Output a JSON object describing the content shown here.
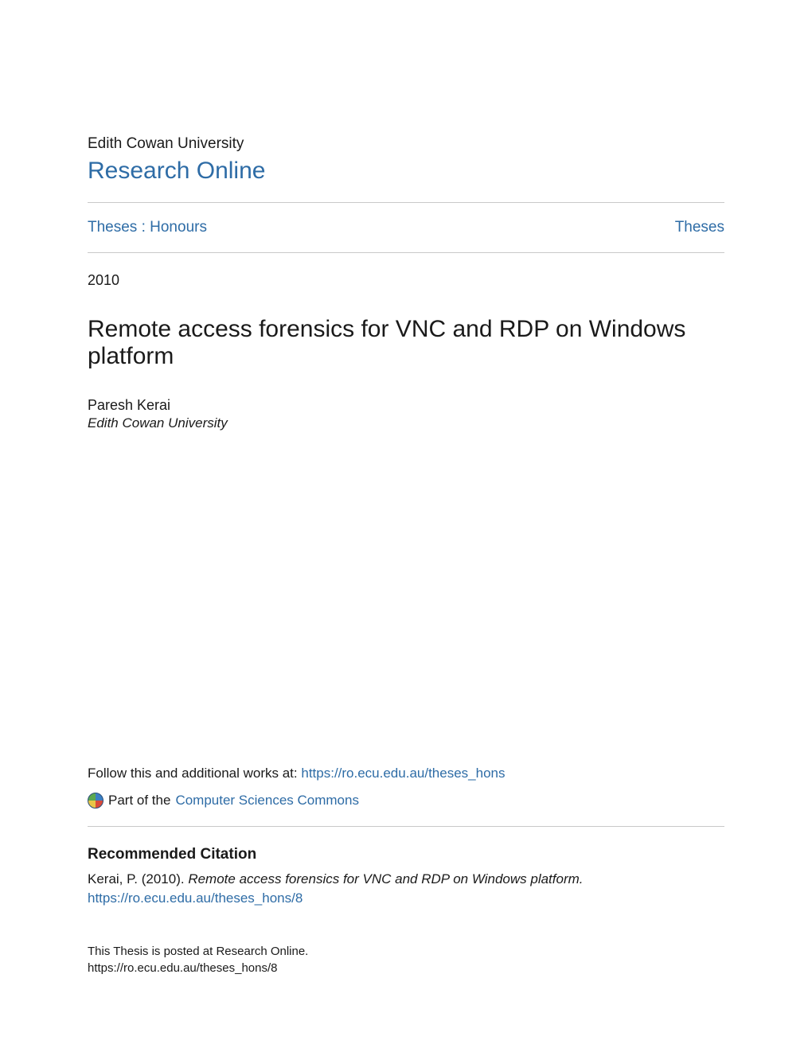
{
  "header": {
    "university": "Edith Cowan University",
    "research_online": "Research Online"
  },
  "links": {
    "left": "Theses : Honours",
    "right": "Theses"
  },
  "year": "2010",
  "title": "Remote access forensics for VNC and RDP on Windows platform",
  "author": {
    "name": "Paresh Kerai",
    "affiliation": "Edith Cowan University"
  },
  "follow": {
    "text": "Follow this and additional works at: ",
    "url": "https://ro.ecu.edu.au/theses_hons"
  },
  "part_of": {
    "text": "Part of the ",
    "link": "Computer Sciences Commons"
  },
  "recommended": {
    "heading": "Recommended Citation",
    "prefix": "Kerai, P. (2010). ",
    "title_italic": "Remote access forensics for VNC and RDP on Windows platform. ",
    "url": "https://ro.ecu.edu.au/theses_hons/8"
  },
  "footer": {
    "line1": "This Thesis is posted at Research Online.",
    "line2": "https://ro.ecu.edu.au/theses_hons/8"
  }
}
